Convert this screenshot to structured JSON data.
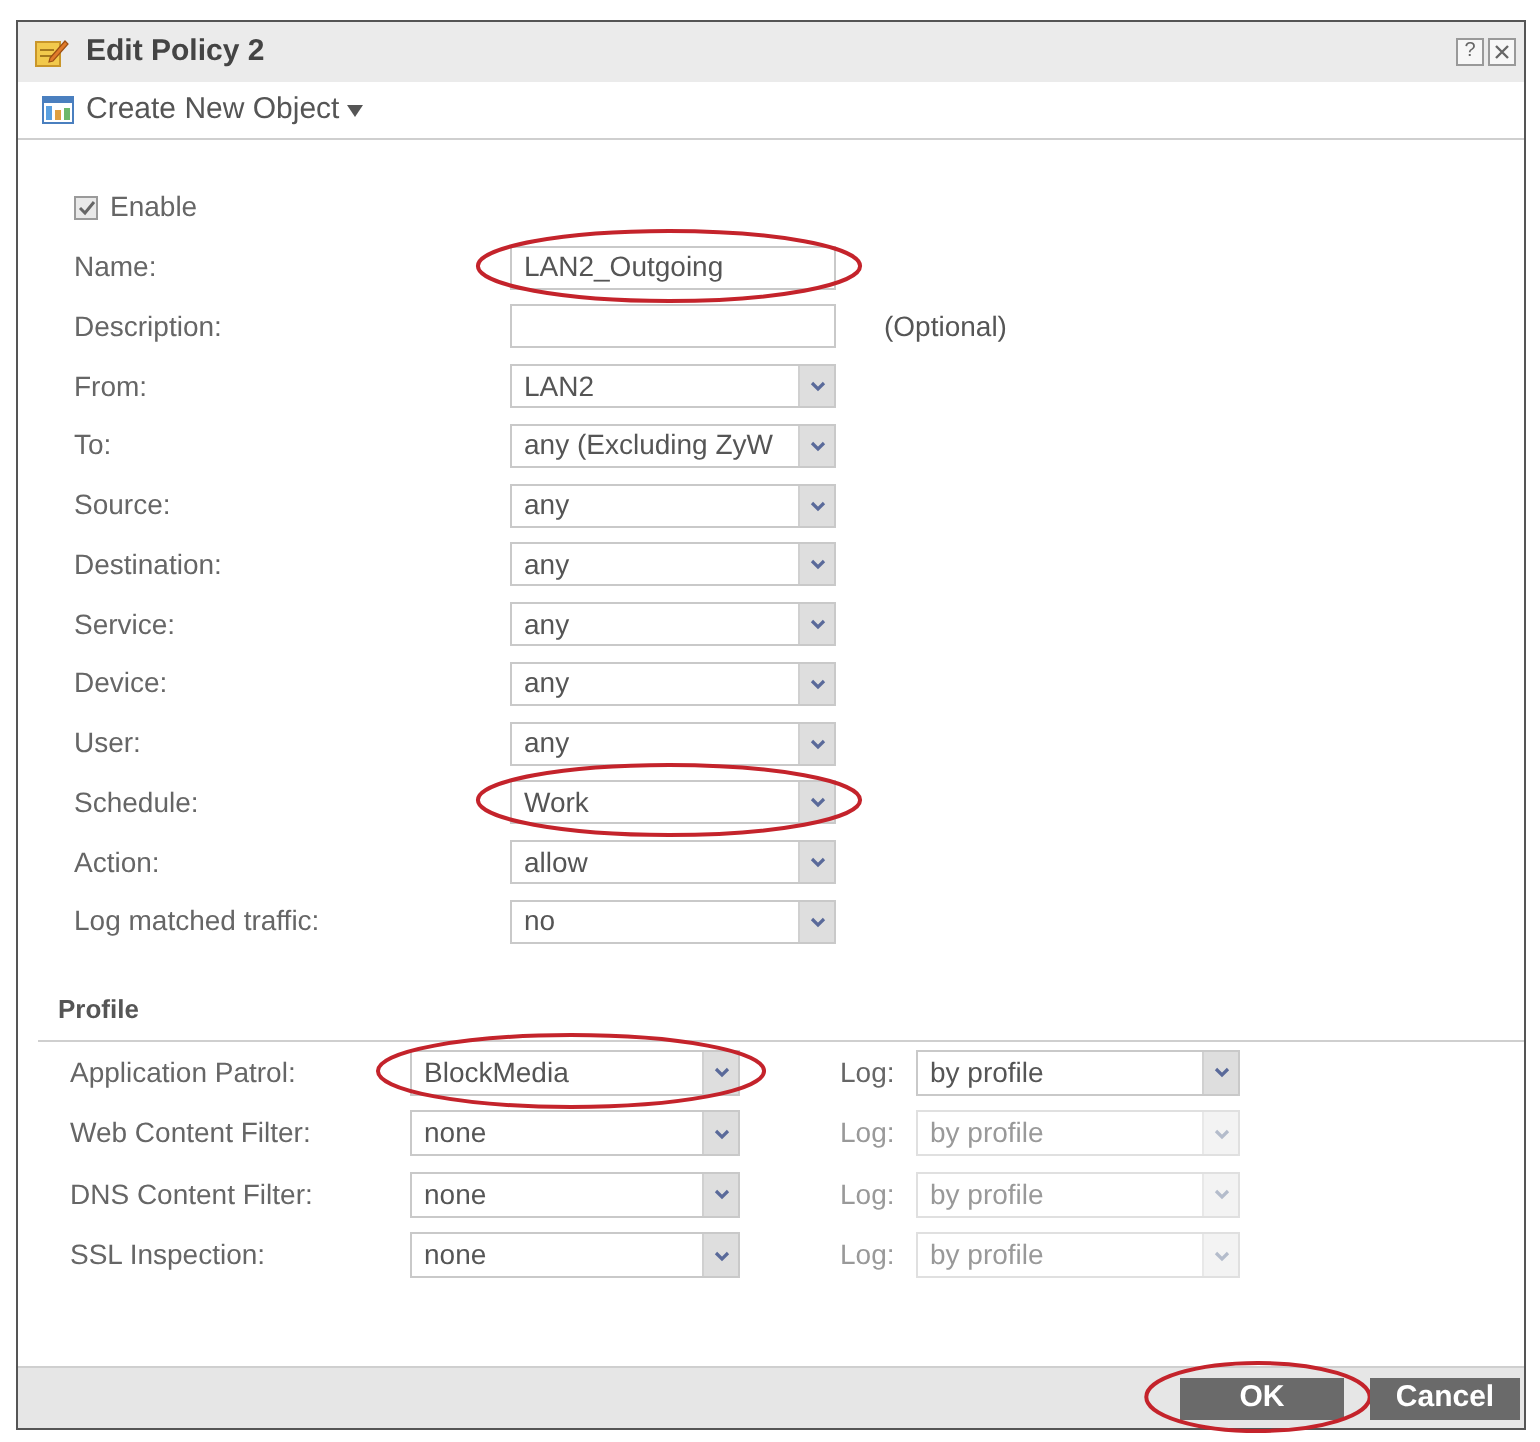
{
  "window": {
    "title": "Edit Policy 2",
    "help_button": "?"
  },
  "toolbar": {
    "menu_label": "Create New Object"
  },
  "form": {
    "enable": {
      "label": "Enable",
      "checked": true
    },
    "rows": [
      {
        "kind": "text",
        "label": "Name:",
        "value": "LAN2_Outgoing",
        "highlighted": true
      },
      {
        "kind": "text",
        "label": "Description:",
        "note": "(Optional)",
        "highlighted": false
      },
      {
        "kind": "select",
        "label": "From:",
        "value": "LAN2",
        "highlighted": false
      },
      {
        "kind": "select",
        "label": "To:",
        "value": "any (Excluding ZyW",
        "highlighted": false
      },
      {
        "kind": "select",
        "label": "Source:",
        "value": "any",
        "highlighted": false
      },
      {
        "kind": "select",
        "label": "Destination:",
        "value": "any",
        "highlighted": false
      },
      {
        "kind": "select",
        "label": "Service:",
        "value": "any",
        "highlighted": false
      },
      {
        "kind": "select",
        "label": "Device:",
        "value": "any",
        "highlighted": false
      },
      {
        "kind": "select",
        "label": "User:",
        "value": "any",
        "highlighted": false
      },
      {
        "kind": "select",
        "label": "Schedule:",
        "value": "Work",
        "highlighted": true
      },
      {
        "kind": "select",
        "label": "Action:",
        "value": "allow",
        "highlighted": false
      },
      {
        "kind": "select",
        "label": "Log matched traffic:",
        "value": "no",
        "highlighted": false
      }
    ]
  },
  "profile": {
    "title": "Profile",
    "rows": [
      {
        "label": "Application Patrol:",
        "value": "BlockMedia",
        "highlighted": true,
        "log": {
          "label": "Log:",
          "value": "by profile",
          "disabled": false
        }
      },
      {
        "label": "Web Content Filter:",
        "value": "none",
        "highlighted": false,
        "log": {
          "label": "Log:",
          "value": "by profile",
          "disabled": true
        }
      },
      {
        "label": "DNS Content Filter:",
        "value": "none",
        "highlighted": false,
        "log": {
          "label": "Log:",
          "value": "by profile",
          "disabled": true
        }
      },
      {
        "label": "SSL Inspection:",
        "value": "none",
        "highlighted": false,
        "log": {
          "label": "Log:",
          "value": "by profile",
          "disabled": true
        }
      }
    ]
  },
  "buttons": [
    {
      "label": "OK",
      "highlighted": true
    },
    {
      "label": "Cancel",
      "highlighted": false
    }
  ]
}
